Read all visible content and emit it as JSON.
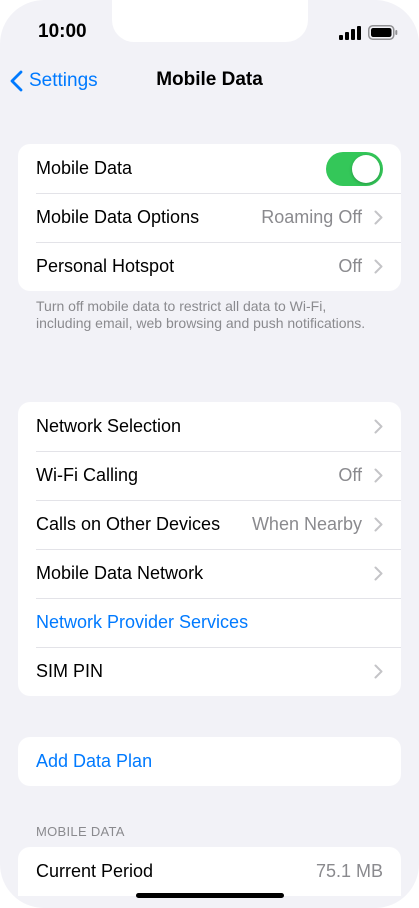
{
  "status_bar": {
    "time": "10:00"
  },
  "nav": {
    "back_label": "Settings",
    "title": "Mobile Data"
  },
  "group1": {
    "mobile_data_label": "Mobile Data",
    "mobile_data_on": true,
    "options_label": "Mobile Data Options",
    "options_value": "Roaming Off",
    "hotspot_label": "Personal Hotspot",
    "hotspot_value": "Off"
  },
  "footnote": "Turn off mobile data to restrict all data to Wi-Fi, including email, web browsing and push notifications.",
  "group2": {
    "network_selection_label": "Network Selection",
    "wifi_calling_label": "Wi-Fi Calling",
    "wifi_calling_value": "Off",
    "calls_other_label": "Calls on Other Devices",
    "calls_other_value": "When Nearby",
    "data_network_label": "Mobile Data Network",
    "provider_services_label": "Network Provider Services",
    "sim_pin_label": "SIM PIN"
  },
  "group3": {
    "add_plan_label": "Add Data Plan"
  },
  "usage_section": {
    "header": "MOBILE DATA",
    "current_period_label": "Current Period",
    "current_period_value": "75.1 MB"
  },
  "colors": {
    "accent": "#007aff",
    "toggle_on": "#34c759",
    "secondary_text": "#8a8a8e",
    "background": "#f2f2f7"
  }
}
